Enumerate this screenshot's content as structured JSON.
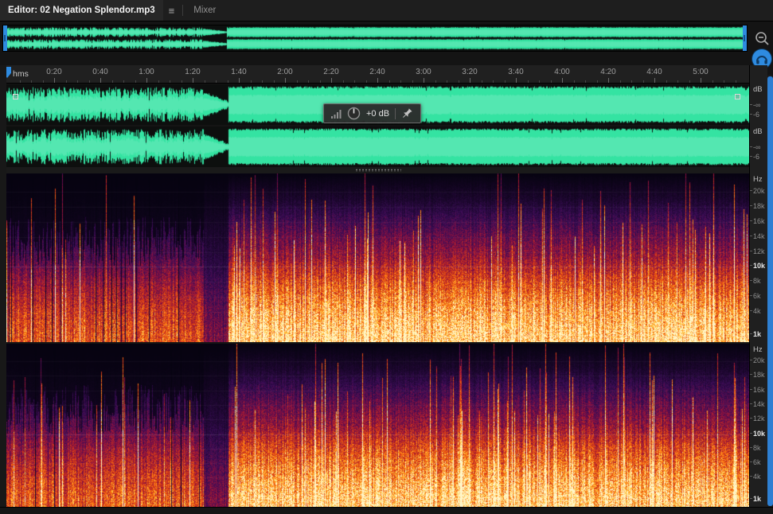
{
  "tabs": {
    "editor": "Editor: 02 Negation Splendor.mp3",
    "mixer": "Mixer",
    "menu_glyph": "≡"
  },
  "timeline": {
    "unit": "hms",
    "ticks": [
      "0:20",
      "0:40",
      "1:00",
      "1:20",
      "1:40",
      "2:00",
      "2:20",
      "2:40",
      "3:00",
      "3:20",
      "3:40",
      "4:00",
      "4:20",
      "4:40",
      "5:00"
    ],
    "seconds_per_tick": 20
  },
  "hud": {
    "gain": "+0 dB"
  },
  "waveform_ruler": {
    "unit": "dB",
    "labels": [
      "-∞",
      "-6"
    ]
  },
  "spectrogram_ruler": {
    "unit": "Hz",
    "labels": [
      "20k",
      "18k",
      "16k",
      "14k",
      "12k",
      "10k",
      "8k",
      "6k",
      "4k",
      "1k"
    ],
    "values_khz": [
      20,
      18,
      16,
      14,
      12,
      10,
      8,
      6,
      4,
      1
    ],
    "bright": [
      "10k",
      "1k"
    ],
    "max_hz": 22430
  },
  "audio": {
    "segments": [
      {
        "start": 0,
        "end": 0.265,
        "type": "intro",
        "level": 0.62
      },
      {
        "start": 0.265,
        "end": 0.298,
        "type": "dip",
        "level": 0.3
      },
      {
        "start": 0.298,
        "end": 1,
        "type": "loud",
        "level": 1
      }
    ],
    "waveform_color": "#34E3A2",
    "spectrogram_palette": [
      "#060310",
      "#3A0C56",
      "#96123C",
      "#D73C14",
      "#FF7A14",
      "#FFC83C",
      "#FFF5C8"
    ]
  },
  "colors": {
    "accent_blue": "#2E8BE0",
    "panel_bg": "#1E1E1E",
    "ruler_bg": "#202020"
  }
}
